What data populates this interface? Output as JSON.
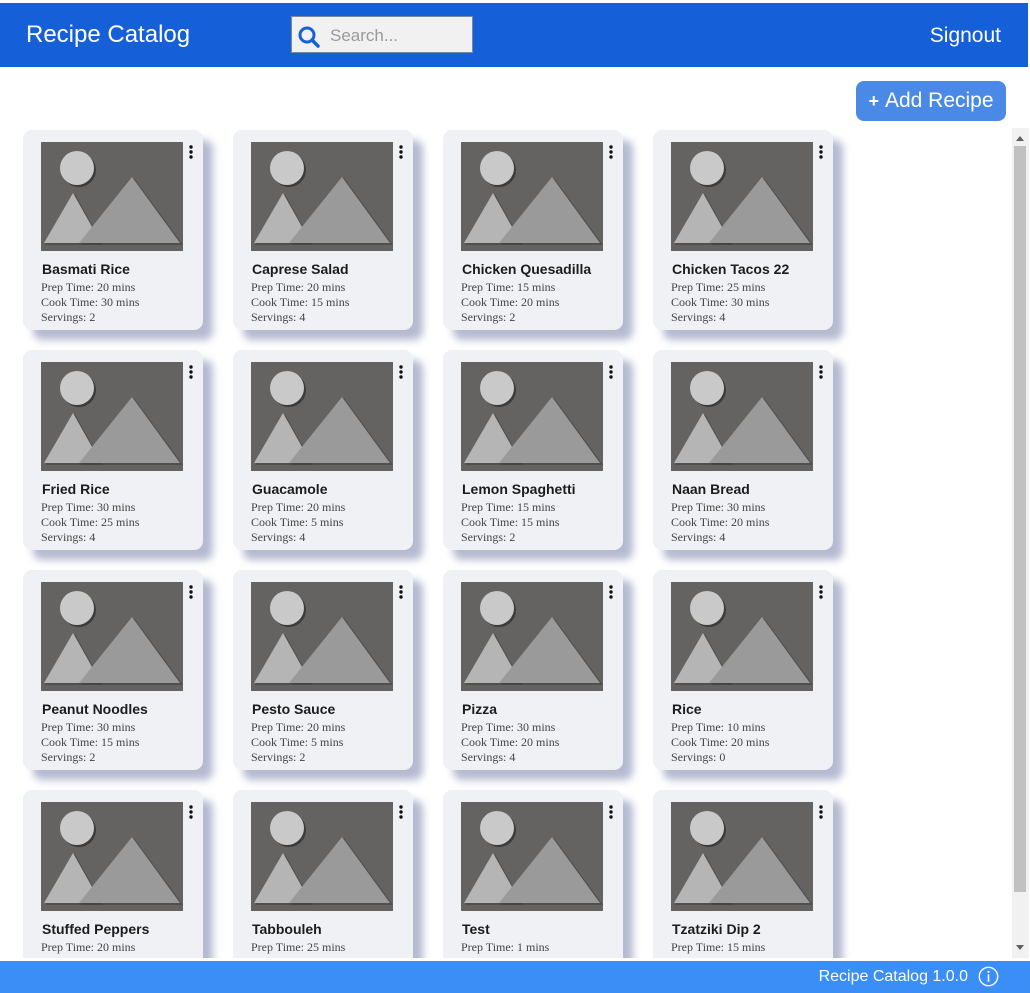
{
  "header": {
    "title": "Recipe Catalog",
    "search_placeholder": "Search...",
    "search_value": "",
    "signout_label": "Signout",
    "bg_color": "#1560d9"
  },
  "toolbar": {
    "add_label": "Add Recipe",
    "add_icon": "plus-icon",
    "add_color": "#4a8ae6"
  },
  "recipes": [
    {
      "name": "Basmati Rice",
      "prep": "Prep Time: 20 mins",
      "cook": "Cook Time: 30 mins",
      "servings": "Servings: 2"
    },
    {
      "name": "Caprese Salad",
      "prep": "Prep Time: 20 mins",
      "cook": "Cook Time: 15 mins",
      "servings": "Servings: 4"
    },
    {
      "name": "Chicken Quesadilla",
      "prep": "Prep Time: 15 mins",
      "cook": "Cook Time: 20 mins",
      "servings": "Servings: 2"
    },
    {
      "name": "Chicken Tacos 22",
      "prep": "Prep Time: 25 mins",
      "cook": "Cook Time: 30 mins",
      "servings": "Servings: 4"
    },
    {
      "name": "Fried Rice",
      "prep": "Prep Time: 30 mins",
      "cook": "Cook Time: 25 mins",
      "servings": "Servings: 4"
    },
    {
      "name": "Guacamole",
      "prep": "Prep Time: 20 mins",
      "cook": "Cook Time: 5 mins",
      "servings": "Servings: 4"
    },
    {
      "name": "Lemon Spaghetti",
      "prep": "Prep Time: 15 mins",
      "cook": "Cook Time: 15 mins",
      "servings": "Servings: 2"
    },
    {
      "name": "Naan Bread",
      "prep": "Prep Time: 30 mins",
      "cook": "Cook Time: 20 mins",
      "servings": "Servings: 4"
    },
    {
      "name": "Peanut Noodles",
      "prep": "Prep Time: 30 mins",
      "cook": "Cook Time: 15 mins",
      "servings": "Servings: 2"
    },
    {
      "name": "Pesto Sauce",
      "prep": "Prep Time: 20 mins",
      "cook": "Cook Time: 5 mins",
      "servings": "Servings: 2"
    },
    {
      "name": "Pizza",
      "prep": "Prep Time: 30 mins",
      "cook": "Cook Time: 20 mins",
      "servings": "Servings: 4"
    },
    {
      "name": "Rice",
      "prep": "Prep Time: 10 mins",
      "cook": "Cook Time: 20 mins",
      "servings": "Servings: 0"
    },
    {
      "name": "Stuffed Peppers",
      "prep": "Prep Time: 20 mins",
      "cook": "",
      "servings": ""
    },
    {
      "name": "Tabbouleh",
      "prep": "Prep Time: 25 mins",
      "cook": "",
      "servings": ""
    },
    {
      "name": "Test",
      "prep": "Prep Time: 1 mins",
      "cook": "",
      "servings": ""
    },
    {
      "name": "Tzatziki Dip 2",
      "prep": "Prep Time: 15 mins",
      "cook": "",
      "servings": ""
    }
  ],
  "card_icons": {
    "thumbnail": "image-placeholder-icon",
    "menu": "more-vertical-icon"
  },
  "footer": {
    "version": "Recipe Catalog 1.0.0",
    "info_icon": "info-icon",
    "bg_color": "#3a8ef5"
  }
}
